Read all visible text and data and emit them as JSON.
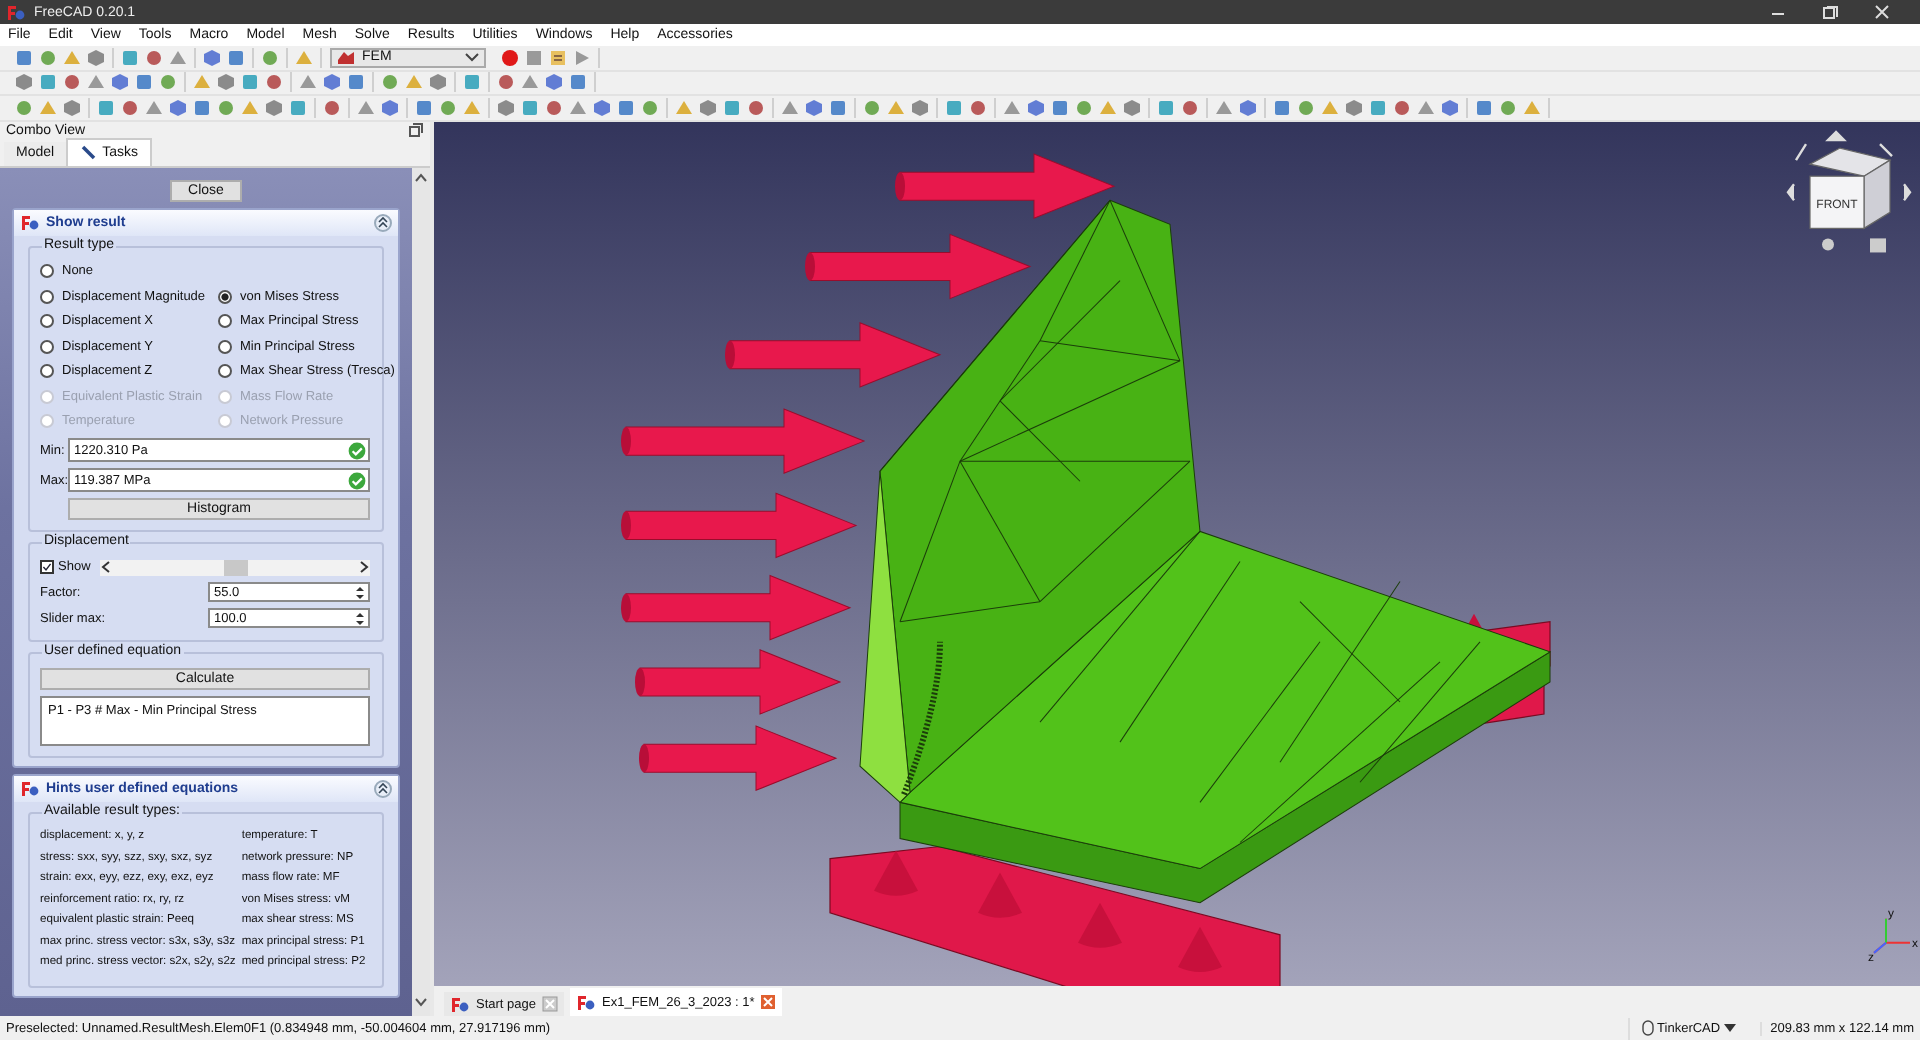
{
  "window": {
    "title": "FreeCAD 0.20.1"
  },
  "menu": [
    "File",
    "Edit",
    "View",
    "Tools",
    "Macro",
    "Model",
    "Mesh",
    "Solve",
    "Results",
    "Utilities",
    "Windows",
    "Help",
    "Accessories"
  ],
  "workbench": "FEM",
  "combo_view": {
    "title": "Combo View",
    "tabs": [
      {
        "label": "Model",
        "selected": false
      },
      {
        "label": "Tasks",
        "selected": true
      }
    ]
  },
  "close_button": "Close",
  "show_result": {
    "title": "Show result",
    "result_type": {
      "title": "Result type",
      "columns": [
        [
          {
            "label": "None",
            "selected": false,
            "disabled": false
          },
          {
            "label": "Displacement Magnitude",
            "selected": false,
            "disabled": false
          },
          {
            "label": "Displacement X",
            "selected": false,
            "disabled": false
          },
          {
            "label": "Displacement Y",
            "selected": false,
            "disabled": false
          },
          {
            "label": "Displacement Z",
            "selected": false,
            "disabled": false
          },
          {
            "label": "Equivalent Plastic Strain",
            "selected": false,
            "disabled": true
          },
          {
            "label": "Temperature",
            "selected": false,
            "disabled": true
          }
        ],
        [
          {
            "label": "von Mises Stress",
            "selected": true,
            "disabled": false
          },
          {
            "label": "Max Principal Stress",
            "selected": false,
            "disabled": false
          },
          {
            "label": "Min Principal Stress",
            "selected": false,
            "disabled": false
          },
          {
            "label": "Max Shear Stress (Tresca)",
            "selected": false,
            "disabled": false
          },
          {
            "label": "Mass Flow Rate",
            "selected": false,
            "disabled": true
          },
          {
            "label": "Network Pressure",
            "selected": false,
            "disabled": true
          }
        ]
      ]
    },
    "min": {
      "label": "Min:",
      "value": "1220.310 Pa"
    },
    "max": {
      "label": "Max:",
      "value": "119.387 MPa"
    },
    "histogram_button": "Histogram",
    "displacement": {
      "title": "Displacement",
      "show": {
        "label": "Show",
        "checked": true
      },
      "slider": {
        "level": 0.5
      },
      "factor": {
        "label": "Factor:",
        "value": "55.0"
      },
      "slider_max": {
        "label": "Slider max:",
        "value": "100.0"
      }
    },
    "equation": {
      "title": "User defined equation",
      "button": "Calculate",
      "value": "P1 - P3 # Max - Min Principal Stress"
    }
  },
  "hints": {
    "title": "Hints user defined equations",
    "group": "Available result types:",
    "rows": [
      [
        "displacement: x, y, z",
        "temperature: T"
      ],
      [
        "stress: sxx, syy, szz, sxy, sxz, syz",
        "network pressure: NP"
      ],
      [
        "strain: exx, eyy, ezz, exy, exz, eyz",
        "mass flow rate: MF"
      ],
      [
        "reinforcement ratio: rx, ry, rz",
        "von Mises stress: vM"
      ],
      [
        "equivalent plastic strain: Peeq",
        "max shear stress: MS"
      ],
      [
        "max princ. stress vector: s3x, s3y, s3z",
        "max principal stress: P1"
      ],
      [
        "med princ. stress vector: s2x, s2y, s2z",
        "med principal stress: P2"
      ]
    ]
  },
  "nav_cube": {
    "face": "FRONT"
  },
  "axes": [
    "x",
    "y",
    "z"
  ],
  "document_tabs": [
    {
      "label": "Start page",
      "selected": false
    },
    {
      "label": "Ex1_FEM_26_3_2023 : 1*",
      "selected": true
    }
  ],
  "status_bar": {
    "message": "Preselected: Unnamed.ResultMesh.Elem0F1 (0.834948 mm, -50.004604 mm, 27.917196 mm)",
    "navigation": "TinkerCAD",
    "dimensions": "209.83 mm x 122.14 mm"
  }
}
